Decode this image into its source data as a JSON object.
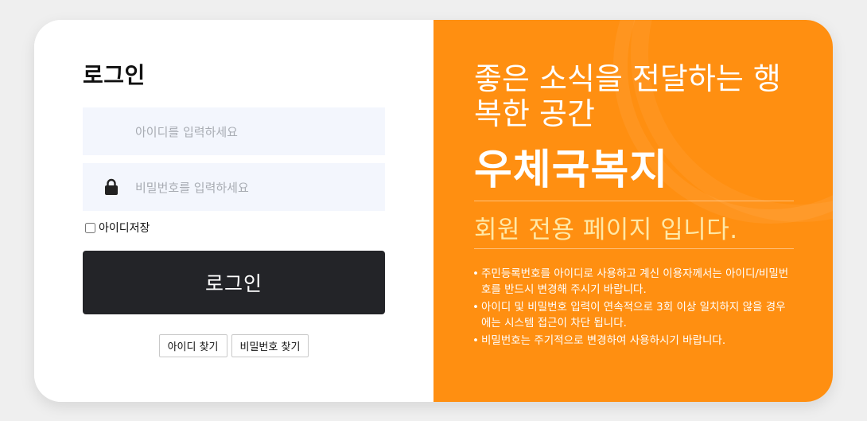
{
  "login": {
    "title": "로그인",
    "id_placeholder": "아이디를 입력하세요",
    "pw_placeholder": "비밀번호를 입력하세요",
    "remember_label": "아이디저장",
    "remember_checked": false,
    "submit_label": "로그인",
    "find_id_label": "아이디 찾기",
    "find_pw_label": "비밀번호 찾기",
    "pw_icon": "lock-icon"
  },
  "banner": {
    "slogan": "좋은 소식을 전달하는 행복한 공간",
    "brand": "우체국복지",
    "member_text": "회원 전용 페이지 입니다.",
    "notices": [
      "주민등록번호를 아이디로 사용하고 계신 이용자께서는 아이디/비밀번호를 반드시 변경해 주시기 바랍니다.",
      "아이디 및 비밀번호 입력이 연속적으로 3회 이상 일치하지 않을 경우에는 시스템 접근이 차단 됩니다.",
      "비밀번호는 주기적으로 변경하여 사용하시기 바랍니다."
    ]
  },
  "colors": {
    "accent": "#ff8f11",
    "button_dark": "#232428",
    "input_bg": "#f3f6fd",
    "member_text": "#ffe8a6"
  }
}
